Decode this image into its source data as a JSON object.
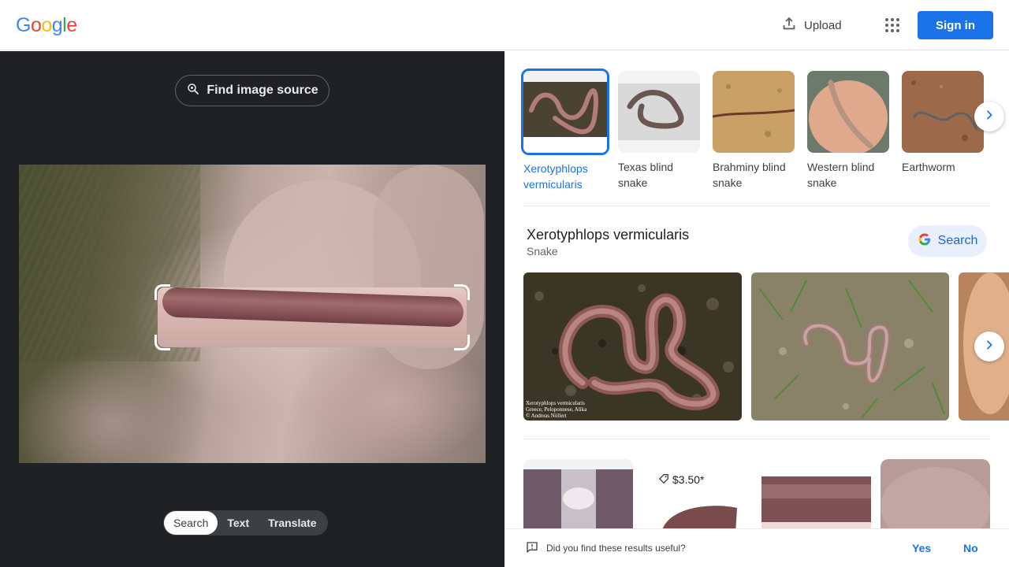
{
  "header": {
    "logo_letters": [
      "G",
      "o",
      "o",
      "g",
      "l",
      "e"
    ],
    "logo_colors": [
      "#4285f4",
      "#ea4335",
      "#fbbc05",
      "#4285f4",
      "#34a853",
      "#ea4335"
    ],
    "upload_label": "Upload",
    "signin_label": "Sign in"
  },
  "left_panel": {
    "find_source_label": "Find image source",
    "modes": [
      {
        "label": "Search",
        "active": true
      },
      {
        "label": "Text",
        "active": false
      },
      {
        "label": "Translate",
        "active": false
      }
    ]
  },
  "related": {
    "chips": [
      {
        "label": "Xerotyphlops vermicularis",
        "selected": true
      },
      {
        "label": "Texas blind snake",
        "selected": false
      },
      {
        "label": "Brahminy blind snake",
        "selected": false
      },
      {
        "label": "Western blind snake",
        "selected": false
      },
      {
        "label": "Earthworm",
        "selected": false
      }
    ]
  },
  "knowledge": {
    "title": "Xerotyphlops vermicularis",
    "subtitle": "Snake",
    "search_label": "Search",
    "image_caption_lines": [
      "Xerotyphlops vermicularis",
      "Greece, Peloponnese, Alika",
      "© Andreas Nöllert"
    ]
  },
  "results": {
    "price": "$3.50*"
  },
  "feedback": {
    "question": "Did you find these results useful?",
    "yes_label": "Yes",
    "no_label": "No"
  },
  "colors": {
    "accent": "#1a73e8",
    "left_bg": "#202124"
  }
}
